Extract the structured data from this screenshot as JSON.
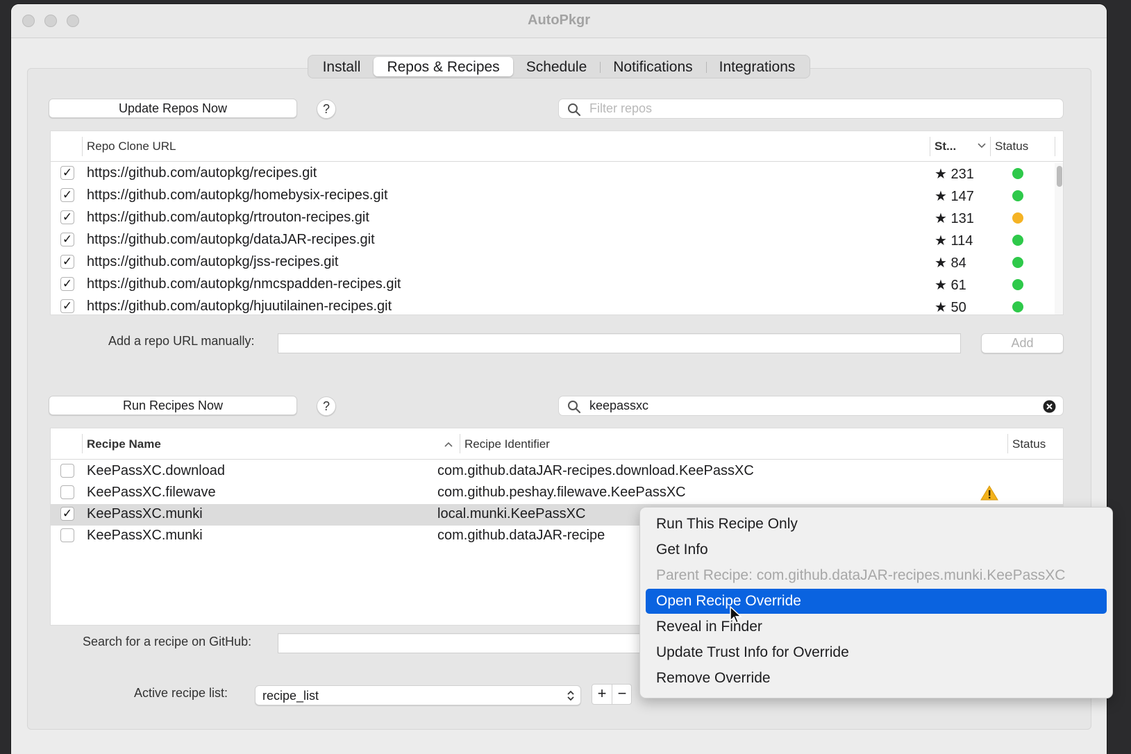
{
  "window": {
    "title": "AutoPkgr"
  },
  "tabs": [
    {
      "label": "Install"
    },
    {
      "label": "Repos & Recipes"
    },
    {
      "label": "Schedule"
    },
    {
      "label": "Notifications"
    },
    {
      "label": "Integrations"
    }
  ],
  "repos": {
    "update_button": "Update Repos Now",
    "help": "?",
    "filter_placeholder": "Filter repos",
    "columns": {
      "url": "Repo Clone URL",
      "stars": "St...",
      "status": "Status"
    },
    "rows": [
      {
        "checked": "✓",
        "url": "https://github.com/autopkg/recipes.git",
        "stars": "★ 231",
        "status_color": "#2ec94a"
      },
      {
        "checked": "✓",
        "url": "https://github.com/autopkg/homebysix-recipes.git",
        "stars": "★ 147",
        "status_color": "#2ec94a"
      },
      {
        "checked": "✓",
        "url": "https://github.com/autopkg/rtrouton-recipes.git",
        "stars": "★ 131",
        "status_color": "#f5b324"
      },
      {
        "checked": "✓",
        "url": "https://github.com/autopkg/dataJAR-recipes.git",
        "stars": "★ 114",
        "status_color": "#2ec94a"
      },
      {
        "checked": "✓",
        "url": "https://github.com/autopkg/jss-recipes.git",
        "stars": "★ 84",
        "status_color": "#2ec94a"
      },
      {
        "checked": "✓",
        "url": "https://github.com/autopkg/nmcspadden-recipes.git",
        "stars": "★ 61",
        "status_color": "#2ec94a"
      },
      {
        "checked": "✓",
        "url": "https://github.com/autopkg/hjuutilainen-recipes.git",
        "stars": "★ 50",
        "status_color": "#2ec94a"
      }
    ],
    "add_label": "Add a repo URL manually:",
    "add_value": "",
    "add_button": "Add"
  },
  "recipes": {
    "run_button": "Run Recipes Now",
    "help": "?",
    "search_value": "keepassxc",
    "columns": {
      "name": "Recipe Name",
      "identifier": "Recipe Identifier",
      "status": "Status"
    },
    "rows": [
      {
        "checked": "",
        "name": "KeePassXC.download",
        "identifier": "com.github.dataJAR-recipes.download.KeePassXC",
        "status_icon": ""
      },
      {
        "checked": "",
        "name": "KeePassXC.filewave",
        "identifier": "com.github.peshay.filewave.KeePassXC",
        "status_icon": "warning-icon"
      },
      {
        "checked": "✓",
        "name": "KeePassXC.munki",
        "identifier": "local.munki.KeePassXC",
        "status_icon": ""
      },
      {
        "checked": "",
        "name": "KeePassXC.munki",
        "identifier": "com.github.dataJAR-recipe",
        "status_icon": ""
      }
    ],
    "github_search_label": "Search for a recipe on GitHub:",
    "github_search_value": "",
    "active_list_label": "Active recipe list:",
    "active_list_value": "recipe_list",
    "add_list": "+",
    "remove_list": "−"
  },
  "context_menu": {
    "items": [
      {
        "label": "Run This Recipe Only"
      },
      {
        "label": "Get Info"
      },
      {
        "label": "Parent Recipe: com.github.dataJAR-recipes.munki.KeePassXC"
      },
      {
        "label": "Open Recipe Override"
      },
      {
        "label": "Reveal in Finder"
      },
      {
        "label": "Update Trust Info for Override"
      },
      {
        "label": "Remove Override"
      }
    ]
  },
  "colors": {
    "accent": "#0a63e0",
    "status_ok": "#2ec94a",
    "status_warn": "#f5b324",
    "warning_icon": "#f3b21c"
  }
}
